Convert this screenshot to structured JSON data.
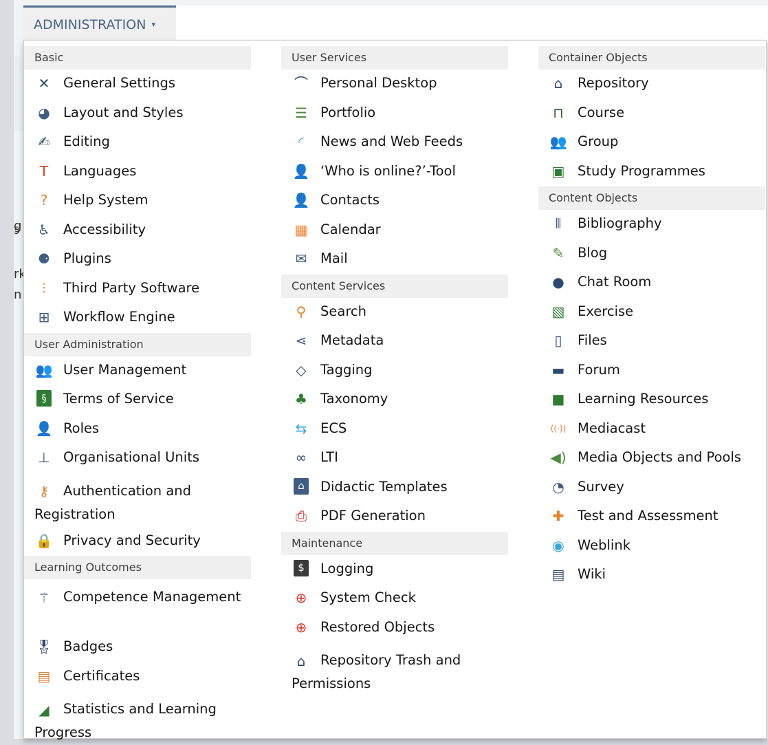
{
  "menu": {
    "title": "ADMINISTRATION",
    "caret": "▾"
  },
  "background": {
    "frag_left": [
      "g",
      "5",
      "rk",
      "n"
    ]
  },
  "columns": [
    {
      "groups": [
        {
          "title": "Basic",
          "items": [
            {
              "label": "General Settings",
              "icon": "tools-icon",
              "glyph": "✕",
              "color": "#2b4a6f"
            },
            {
              "label": "Layout and Styles",
              "icon": "palette-icon",
              "glyph": "◕",
              "color": "#3f5c82"
            },
            {
              "label": "Editing",
              "icon": "pen-icon",
              "glyph": "✍",
              "color": "#2b4a6f"
            },
            {
              "label": "Languages",
              "icon": "languages-icon",
              "glyph": "T",
              "color": "#d8492c"
            },
            {
              "label": "Help System",
              "icon": "help-icon",
              "glyph": "?",
              "color": "#ee7d24"
            },
            {
              "label": "Accessibility",
              "icon": "accessibility-icon",
              "glyph": "♿",
              "color": "#3f5c82"
            },
            {
              "label": "Plugins",
              "icon": "plug-icon",
              "glyph": "⚈",
              "color": "#3f5c82"
            },
            {
              "label": "Third Party Software",
              "icon": "sliders-icon",
              "glyph": "⫶",
              "color": "#ee7d24"
            },
            {
              "label": "Workflow Engine",
              "icon": "workflow-icon",
              "glyph": "⊞",
              "color": "#3f5c82"
            }
          ]
        },
        {
          "title": "User Administration",
          "items": [
            {
              "label": "User Management",
              "icon": "users-icon",
              "glyph": "👥",
              "color": "#4c8a3c"
            },
            {
              "label": "Terms of Service",
              "icon": "terms-icon",
              "glyph": "§",
              "color": "#ffffff",
              "bg": "#2f7d32"
            },
            {
              "label": "Roles",
              "icon": "role-icon",
              "glyph": "👤",
              "color": "#3f5c82"
            },
            {
              "label": "Organisational Units",
              "icon": "org-units-icon",
              "glyph": "⊥",
              "color": "#3f5c82"
            },
            {
              "label": "Authentication and Registration",
              "icon": "key-icon",
              "glyph": "⚷",
              "color": "#ee7d24",
              "two": true
            },
            {
              "label": "Privacy and Security",
              "icon": "lock-icon",
              "glyph": "🔒",
              "color": "#2b4a6f"
            }
          ]
        },
        {
          "title": "Learning Outcomes",
          "items": [
            {
              "label": "Competence Management",
              "icon": "wand-icon",
              "glyph": "⚚",
              "color": "#2b4a6f",
              "two": true
            },
            {
              "label": "Badges",
              "icon": "badge-icon",
              "glyph": "🎖",
              "color": "#2b4a6f"
            },
            {
              "label": "Certificates",
              "icon": "certificate-icon",
              "glyph": "▤",
              "color": "#d8823c"
            },
            {
              "label": "Statistics and Learning Progress",
              "icon": "chart-icon",
              "glyph": "◢",
              "color": "#2f7d32",
              "two": true
            }
          ]
        }
      ]
    },
    {
      "groups": [
        {
          "title": "User Services",
          "items": [
            {
              "label": "Personal Desktop",
              "icon": "desk-lamp-icon",
              "glyph": "⌒",
              "color": "#2b4a6f"
            },
            {
              "label": "Portfolio",
              "icon": "portfolio-icon",
              "glyph": "☰",
              "color": "#4c8a3c"
            },
            {
              "label": "News and Web Feeds",
              "icon": "rss-icon",
              "glyph": "◜",
              "color": "#3aa6d9"
            },
            {
              "label": "‘Who is online?’-Tool",
              "icon": "user-online-icon",
              "glyph": "👤",
              "color": "#4c8a3c"
            },
            {
              "label": "Contacts",
              "icon": "contact-icon",
              "glyph": "👤",
              "color": "#4c8a3c"
            },
            {
              "label": "Calendar",
              "icon": "calendar-icon",
              "glyph": "▦",
              "color": "#ee7d24"
            },
            {
              "label": "Mail",
              "icon": "mail-icon",
              "glyph": "✉",
              "color": "#3f5c82"
            }
          ]
        },
        {
          "title": "Content Services",
          "items": [
            {
              "label": "Search",
              "icon": "search-icon",
              "glyph": "⚲",
              "color": "#ee7d24"
            },
            {
              "label": "Metadata",
              "icon": "share-icon",
              "glyph": "⋖",
              "color": "#3f5c82"
            },
            {
              "label": "Tagging",
              "icon": "tag-icon",
              "glyph": "◇",
              "color": "#2b4a6f"
            },
            {
              "label": "Taxonomy",
              "icon": "tree-icon",
              "glyph": "♣",
              "color": "#2f7d32"
            },
            {
              "label": "ECS",
              "icon": "ecs-icon",
              "glyph": "⇆",
              "color": "#3aa6d9"
            },
            {
              "label": "LTI",
              "icon": "link-icon",
              "glyph": "∞",
              "color": "#2b4a6f"
            },
            {
              "label": "Didactic Templates",
              "icon": "template-icon",
              "glyph": "⌂",
              "color": "#ffffff",
              "bg": "#3f5c82"
            },
            {
              "label": "PDF Generation",
              "icon": "pdf-icon",
              "glyph": "⎙",
              "color": "#d8392c"
            }
          ]
        },
        {
          "title": "Maintenance",
          "items": [
            {
              "label": "Logging",
              "icon": "terminal-icon",
              "glyph": "$",
              "color": "#ffffff",
              "bg": "#3a3a3a"
            },
            {
              "label": "System Check",
              "icon": "lifebuoy-icon",
              "glyph": "⊕",
              "color": "#d8392c"
            },
            {
              "label": "Restored Objects",
              "icon": "lifebuoy-icon",
              "glyph": "⊕",
              "color": "#d8392c"
            },
            {
              "label": "Repository Trash and Permissions",
              "icon": "repository-icon",
              "glyph": "⌂",
              "color": "#2b4a6f",
              "two": true
            }
          ]
        }
      ]
    },
    {
      "groups": [
        {
          "title": "Container Objects",
          "items": [
            {
              "label": "Repository",
              "icon": "repository-icon",
              "glyph": "⌂",
              "color": "#2b4a6f"
            },
            {
              "label": "Course",
              "icon": "course-icon",
              "glyph": "⊓",
              "color": "#2f5e2f"
            },
            {
              "label": "Group",
              "icon": "group-icon",
              "glyph": "👥",
              "color": "#3f5c82"
            },
            {
              "label": "Study Programmes",
              "icon": "study-programme-icon",
              "glyph": "▣",
              "color": "#2f7d32"
            }
          ]
        },
        {
          "title": "Content Objects",
          "items": [
            {
              "label": "Bibliography",
              "icon": "books-icon",
              "glyph": "⫴",
              "color": "#3f5c82"
            },
            {
              "label": "Blog",
              "icon": "blog-icon",
              "glyph": "✎",
              "color": "#4c8a3c"
            },
            {
              "label": "Chat Room",
              "icon": "chat-icon",
              "glyph": "●",
              "color": "#2b4a6f"
            },
            {
              "label": "Exercise",
              "icon": "exercise-icon",
              "glyph": "▧",
              "color": "#2f7d32"
            },
            {
              "label": "Files",
              "icon": "file-icon",
              "glyph": "▯",
              "color": "#2b4a6f"
            },
            {
              "label": "Forum",
              "icon": "forum-icon",
              "glyph": "▬",
              "color": "#2b4a6f"
            },
            {
              "label": "Learning Resources",
              "icon": "learning-resource-icon",
              "glyph": "■",
              "color": "#2f7d32"
            },
            {
              "label": "Mediacast",
              "icon": "mediacast-icon",
              "glyph": "((·))",
              "color": "#ee7d24"
            },
            {
              "label": "Media Objects and Pools",
              "icon": "speaker-icon",
              "glyph": "◀)",
              "color": "#4c8a3c"
            },
            {
              "label": "Survey",
              "icon": "survey-icon",
              "glyph": "◔",
              "color": "#3f5c82"
            },
            {
              "label": "Test and Assessment",
              "icon": "puzzle-icon",
              "glyph": "✚",
              "color": "#ee7d24"
            },
            {
              "label": "Weblink",
              "icon": "globe-icon",
              "glyph": "◉",
              "color": "#3aa6d9"
            },
            {
              "label": "Wiki",
              "icon": "wiki-icon",
              "glyph": "▤",
              "color": "#2b4a6f"
            }
          ]
        }
      ]
    }
  ]
}
